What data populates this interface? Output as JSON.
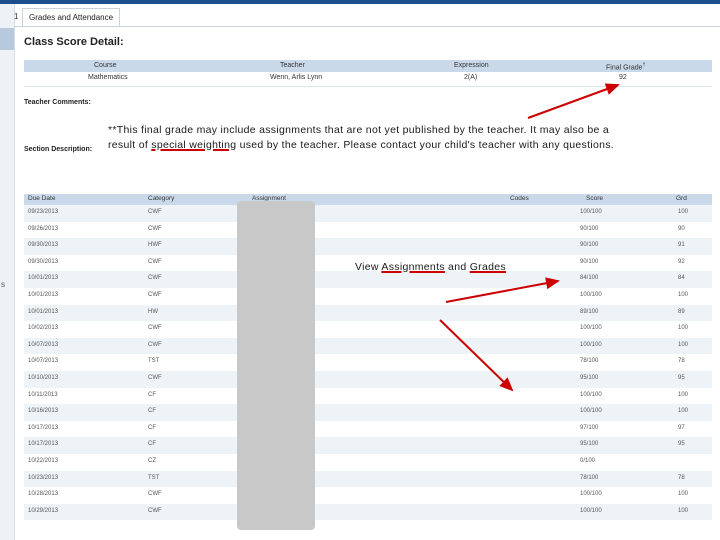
{
  "tab_number": "1",
  "tab_label": "Grades and Attendance",
  "side_marker": "s",
  "page_title": "Class Score Detail:",
  "summary": {
    "headers": [
      "Course",
      "Teacher",
      "Expression",
      "Final Grade"
    ],
    "final_grade_sup": "†",
    "row": [
      "Mathematics",
      "Wenn, Arlis Lynn",
      "2(A)",
      "92"
    ]
  },
  "labels": {
    "teacher_comments": "Teacher Comments:",
    "section_description": "Section Description:"
  },
  "note": {
    "line1": "**This final grade may include assignments that are not yet published by the teacher. It may also be a",
    "line2_pre": "result of ",
    "line2_link": "special weighting",
    "line2_post": " used by the teacher.  Please contact your child's teacher with any questions."
  },
  "view_text": {
    "pre": "View ",
    "link1": "Assignments",
    "mid": " and ",
    "link2": "Grades"
  },
  "assignments": {
    "headers": [
      "Due Date",
      "Category",
      "Assignment",
      "Codes",
      "Score",
      "Grd"
    ],
    "rows": [
      [
        "09/23/2013",
        "CWF",
        "",
        "",
        "100/100",
        "100"
      ],
      [
        "09/26/2013",
        "CWF",
        "",
        "",
        "90/100",
        "90"
      ],
      [
        "09/30/2013",
        "HWF",
        "",
        "",
        "90/100",
        "91"
      ],
      [
        "09/30/2013",
        "CWF",
        "",
        "",
        "90/100",
        "92"
      ],
      [
        "10/01/2013",
        "CWF",
        "",
        "",
        "84/100",
        "84"
      ],
      [
        "10/01/2013",
        "CWF",
        "",
        "",
        "100/100",
        "100"
      ],
      [
        "10/01/2013",
        "HW",
        "",
        "",
        "89/100",
        "89"
      ],
      [
        "10/02/2013",
        "CWF",
        "",
        "",
        "100/100",
        "100"
      ],
      [
        "10/07/2013",
        "CWF",
        "",
        "",
        "100/100",
        "100"
      ],
      [
        "10/07/2013",
        "TST",
        "",
        "",
        "78/100",
        "78"
      ],
      [
        "10/10/2013",
        "CWF",
        "",
        "",
        "95/100",
        "95"
      ],
      [
        "10/11/2013",
        "CF",
        "",
        "",
        "100/100",
        "100"
      ],
      [
        "10/16/2013",
        "CF",
        "",
        "",
        "100/100",
        "100"
      ],
      [
        "10/17/2013",
        "CF",
        "",
        "",
        "97/100",
        "97"
      ],
      [
        "10/17/2013",
        "CF",
        "",
        "",
        "95/100",
        "95"
      ],
      [
        "10/22/2013",
        "CZ",
        "",
        "",
        "0/100",
        ""
      ],
      [
        "10/23/2013",
        "TST",
        "",
        "",
        "78/100",
        "78"
      ],
      [
        "10/28/2013",
        "CWF",
        "",
        "",
        "100/100",
        "100"
      ],
      [
        "10/29/2013",
        "CWF",
        "",
        "",
        "100/100",
        "100"
      ]
    ]
  },
  "colors": {
    "header_bg": "#c9d9ea",
    "arrow": "#cc0000",
    "redacted": "#c8c8c8"
  }
}
